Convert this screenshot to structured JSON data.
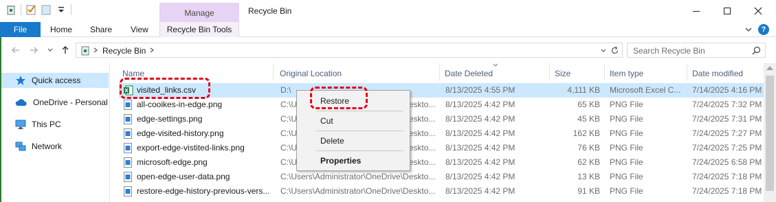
{
  "window": {
    "title": "Recycle Bin",
    "context_tab_group": "Manage"
  },
  "ribbon": {
    "tabs": [
      "File",
      "Home",
      "Share",
      "View",
      "Recycle Bin Tools"
    ]
  },
  "address": {
    "path": "Recycle Bin",
    "search_placeholder": "Search Recycle Bin"
  },
  "nav": {
    "items": [
      "Quick access",
      "OneDrive - Personal",
      "This PC",
      "Network"
    ]
  },
  "columns": [
    "Name",
    "Original Location",
    "Date Deleted",
    "Size",
    "Item type",
    "Date modified"
  ],
  "files": [
    {
      "name": "visited_links.csv",
      "orig": "D:\\",
      "deleted": "8/13/2025 4:55 PM",
      "size": "4,111 KB",
      "type": "Microsoft Excel C...",
      "modified": "7/14/2025 4:16 PM",
      "icon": "excel-icon"
    },
    {
      "name": "all-cooikes-in-edge.png",
      "orig": "C:\\Users\\Administrator\\OneDrive\\Deskto...",
      "deleted": "8/13/2025 4:42 PM",
      "size": "65 KB",
      "type": "PNG File",
      "modified": "7/24/2025 7:32 PM",
      "icon": "image-file-icon"
    },
    {
      "name": "edge-settings.png",
      "orig": "C:\\Users\\Administrator\\OneDrive\\Deskto...",
      "deleted": "8/13/2025 4:42 PM",
      "size": "45 KB",
      "type": "PNG File",
      "modified": "7/24/2025 7:31 PM",
      "icon": "image-file-icon"
    },
    {
      "name": "edge-visited-history.png",
      "orig": "C:\\Users\\Administrator\\OneDrive\\Deskto...",
      "deleted": "8/13/2025 4:42 PM",
      "size": "162 KB",
      "type": "PNG File",
      "modified": "7/24/2025 7:27 PM",
      "icon": "image-file-icon"
    },
    {
      "name": "export-edge-vistited-links.png",
      "orig": "C:\\Users\\Administrator\\OneDrive\\Deskto...",
      "deleted": "8/13/2025 4:42 PM",
      "size": "76 KB",
      "type": "PNG File",
      "modified": "7/24/2025 7:25 PM",
      "icon": "image-file-icon"
    },
    {
      "name": "microsoft-edge.png",
      "orig": "C:\\Users\\Administrator\\OneDrive\\Deskto...",
      "deleted": "8/13/2025 4:42 PM",
      "size": "62 KB",
      "type": "PNG File",
      "modified": "7/24/2025 6:58 PM",
      "icon": "image-file-icon"
    },
    {
      "name": "open-edge-user-data.png",
      "orig": "C:\\Users\\Administrator\\OneDrive\\Deskto...",
      "deleted": "8/13/2025 4:42 PM",
      "size": "13 KB",
      "type": "PNG File",
      "modified": "7/24/2025 7:18 PM",
      "icon": "image-file-icon"
    },
    {
      "name": "restore-edge-history-previous-vers...",
      "orig": "C:\\Users\\Administrator\\OneDrive\\Deskto...",
      "deleted": "8/13/2025 4:42 PM",
      "size": "91 KB",
      "type": "PNG File",
      "modified": "7/24/2025 7:18 PM",
      "icon": "image-file-icon"
    }
  ],
  "context_menu": {
    "items": [
      "Restore",
      "Cut",
      "Delete",
      "Properties"
    ]
  },
  "colors": {
    "file_tab": "#1979ca",
    "manage_tab": "#e7d3f3",
    "selection": "#cce8ff",
    "annotation": "#e3001b"
  }
}
